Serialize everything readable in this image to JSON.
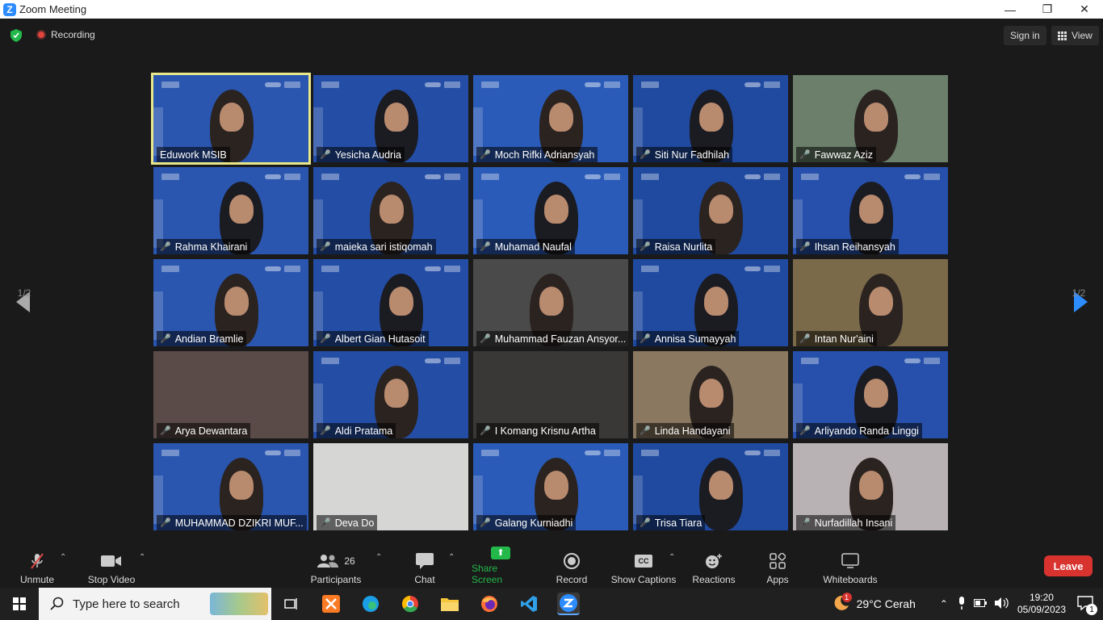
{
  "window": {
    "title": "Zoom Meeting",
    "minimize": "—",
    "restore": "❐",
    "close": "✕"
  },
  "topbar": {
    "recording": "Recording",
    "signin": "Sign in",
    "view": "View"
  },
  "pager": {
    "left": "1/2",
    "right": "1/2"
  },
  "participants": [
    {
      "name": "Eduwork MSIB",
      "muted": false,
      "active": true
    },
    {
      "name": "Yesicha Audria",
      "muted": true
    },
    {
      "name": "Moch Rifki Adriansyah",
      "muted": true
    },
    {
      "name": "Siti Nur Fadhilah",
      "muted": true
    },
    {
      "name": "Fawwaz Aziz",
      "muted": true
    },
    {
      "name": "Rahma Khairani",
      "muted": true
    },
    {
      "name": "maieka sari istiqomah",
      "muted": true
    },
    {
      "name": "Muhamad Naufal",
      "muted": true
    },
    {
      "name": "Raisa Nurlita",
      "muted": true
    },
    {
      "name": "Ihsan Reihansyah",
      "muted": true
    },
    {
      "name": "Andian Bramlie",
      "muted": true
    },
    {
      "name": "Albert Gian Hutasoit",
      "muted": true
    },
    {
      "name": "Muhammad Fauzan Ansyor...",
      "muted": true
    },
    {
      "name": "Annisa Sumayyah",
      "muted": true
    },
    {
      "name": "Intan Nur'aini",
      "muted": true
    },
    {
      "name": "Arya Dewantara",
      "muted": true
    },
    {
      "name": "Aldi Pratama",
      "muted": true
    },
    {
      "name": "I Komang Krisnu Artha",
      "muted": true
    },
    {
      "name": "Linda Handayani",
      "muted": true
    },
    {
      "name": "Arliyando Randa Linggi",
      "muted": true
    },
    {
      "name": "MUHAMMAD DZIKRI MUF...",
      "muted": true
    },
    {
      "name": "Deva Do",
      "muted": true
    },
    {
      "name": "Galang Kurniadhi",
      "muted": true
    },
    {
      "name": "Trisa Tiara",
      "muted": true
    },
    {
      "name": "Nurfadillah Insani",
      "muted": true
    }
  ],
  "toolbar": {
    "unmute": "Unmute",
    "stop_video": "Stop Video",
    "participants": "Participants",
    "participants_count": "26",
    "chat": "Chat",
    "share_screen": "Share Screen",
    "record": "Record",
    "show_captions": "Show Captions",
    "captions_icon": "CC",
    "reactions": "Reactions",
    "apps": "Apps",
    "whiteboards": "Whiteboards",
    "leave": "Leave"
  },
  "taskbar": {
    "search_placeholder": "Type here to search",
    "weather": "29°C  Cerah",
    "weather_badge": "1",
    "time": "19:20",
    "date": "05/09/2023",
    "notifications": "1"
  },
  "colors": {
    "accent": "#2d8cff",
    "share_green": "#23b84a",
    "leave_red": "#d8332f",
    "active_outline": "#e8e88a"
  }
}
